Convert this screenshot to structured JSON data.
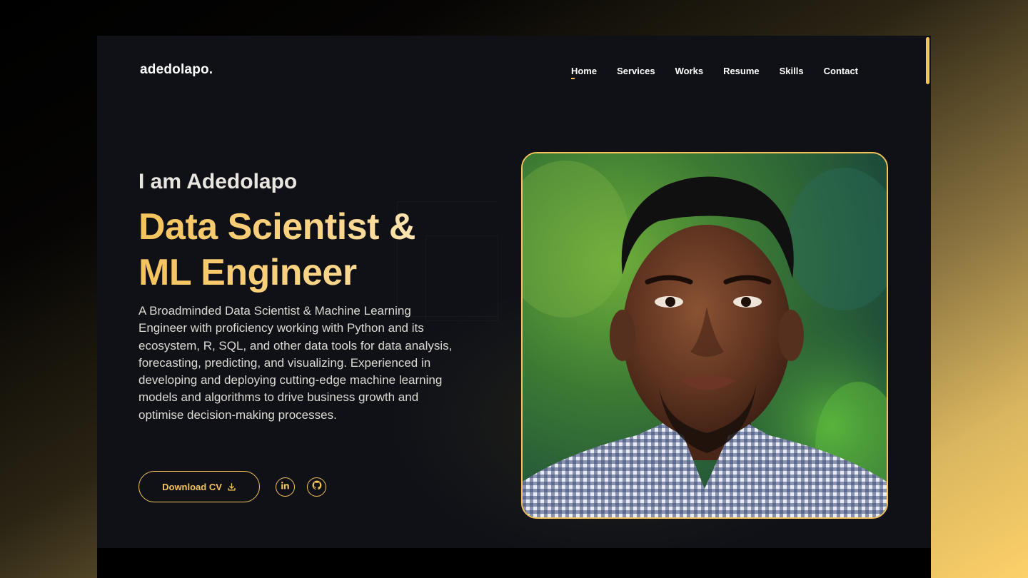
{
  "brand": {
    "logo": "adedolapo."
  },
  "nav": {
    "items": [
      {
        "label": "Home",
        "active": true
      },
      {
        "label": "Services"
      },
      {
        "label": "Works"
      },
      {
        "label": "Resume"
      },
      {
        "label": "Skills"
      },
      {
        "label": "Contact"
      }
    ]
  },
  "hero": {
    "greeting": "I am Adedolapo",
    "title_line1": "Data Scientist &",
    "title_line2": "ML Engineer",
    "description": "A Broadminded Data Scientist & Machine Learning Engineer with proficiency working with Python and its ecosystem, R, SQL, and other data tools for data analysis, forecasting, predicting, and visualizing. Experienced in developing and deploying cutting-edge machine learning models and algorithms to drive business growth and optimise decision-making processes.",
    "cta_label": "Download CV",
    "cta_icon": "download-icon",
    "socials": [
      {
        "icon": "linkedin-icon"
      },
      {
        "icon": "github-icon"
      }
    ],
    "portrait_icon": "profile-photo"
  },
  "colors": {
    "accent": "#f5c35c",
    "background": "#0f1117",
    "text": "#ffffff"
  }
}
